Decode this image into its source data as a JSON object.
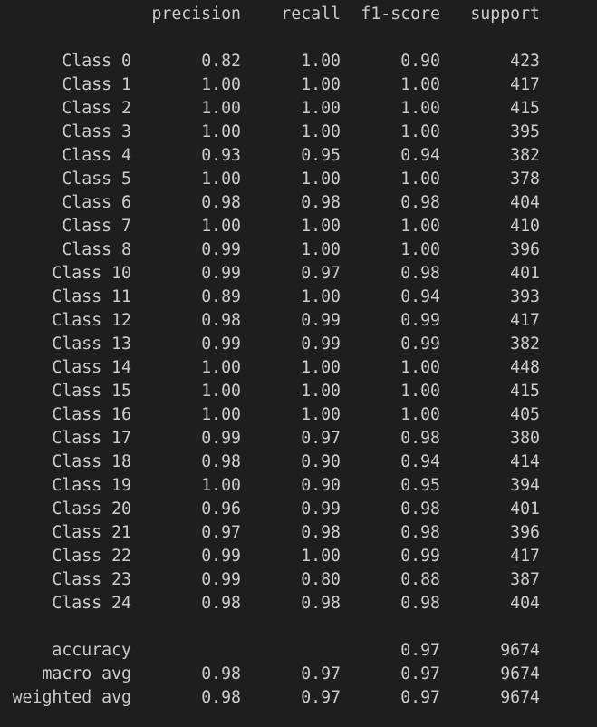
{
  "report": {
    "headers": [
      "precision",
      "recall",
      "f1-score",
      "support"
    ],
    "rows": [
      {
        "label": "Class 0",
        "precision": "0.82",
        "recall": "1.00",
        "f1": "0.90",
        "support": "423"
      },
      {
        "label": "Class 1",
        "precision": "1.00",
        "recall": "1.00",
        "f1": "1.00",
        "support": "417"
      },
      {
        "label": "Class 2",
        "precision": "1.00",
        "recall": "1.00",
        "f1": "1.00",
        "support": "415"
      },
      {
        "label": "Class 3",
        "precision": "1.00",
        "recall": "1.00",
        "f1": "1.00",
        "support": "395"
      },
      {
        "label": "Class 4",
        "precision": "0.93",
        "recall": "0.95",
        "f1": "0.94",
        "support": "382"
      },
      {
        "label": "Class 5",
        "precision": "1.00",
        "recall": "1.00",
        "f1": "1.00",
        "support": "378"
      },
      {
        "label": "Class 6",
        "precision": "0.98",
        "recall": "0.98",
        "f1": "0.98",
        "support": "404"
      },
      {
        "label": "Class 7",
        "precision": "1.00",
        "recall": "1.00",
        "f1": "1.00",
        "support": "410"
      },
      {
        "label": "Class 8",
        "precision": "0.99",
        "recall": "1.00",
        "f1": "1.00",
        "support": "396"
      },
      {
        "label": "Class 10",
        "precision": "0.99",
        "recall": "0.97",
        "f1": "0.98",
        "support": "401"
      },
      {
        "label": "Class 11",
        "precision": "0.89",
        "recall": "1.00",
        "f1": "0.94",
        "support": "393"
      },
      {
        "label": "Class 12",
        "precision": "0.98",
        "recall": "0.99",
        "f1": "0.99",
        "support": "417"
      },
      {
        "label": "Class 13",
        "precision": "0.99",
        "recall": "0.99",
        "f1": "0.99",
        "support": "382"
      },
      {
        "label": "Class 14",
        "precision": "1.00",
        "recall": "1.00",
        "f1": "1.00",
        "support": "448"
      },
      {
        "label": "Class 15",
        "precision": "1.00",
        "recall": "1.00",
        "f1": "1.00",
        "support": "415"
      },
      {
        "label": "Class 16",
        "precision": "1.00",
        "recall": "1.00",
        "f1": "1.00",
        "support": "405"
      },
      {
        "label": "Class 17",
        "precision": "0.99",
        "recall": "0.97",
        "f1": "0.98",
        "support": "380"
      },
      {
        "label": "Class 18",
        "precision": "0.98",
        "recall": "0.90",
        "f1": "0.94",
        "support": "414"
      },
      {
        "label": "Class 19",
        "precision": "1.00",
        "recall": "0.90",
        "f1": "0.95",
        "support": "394"
      },
      {
        "label": "Class 20",
        "precision": "0.96",
        "recall": "0.99",
        "f1": "0.98",
        "support": "401"
      },
      {
        "label": "Class 21",
        "precision": "0.97",
        "recall": "0.98",
        "f1": "0.98",
        "support": "396"
      },
      {
        "label": "Class 22",
        "precision": "0.99",
        "recall": "1.00",
        "f1": "0.99",
        "support": "417"
      },
      {
        "label": "Class 23",
        "precision": "0.99",
        "recall": "0.80",
        "f1": "0.88",
        "support": "387"
      },
      {
        "label": "Class 24",
        "precision": "0.98",
        "recall": "0.98",
        "f1": "0.98",
        "support": "404"
      }
    ],
    "summary": [
      {
        "label": "accuracy",
        "precision": "",
        "recall": "",
        "f1": "0.97",
        "support": "9674"
      },
      {
        "label": "macro avg",
        "precision": "0.98",
        "recall": "0.97",
        "f1": "0.97",
        "support": "9674"
      },
      {
        "label": "weighted avg",
        "precision": "0.98",
        "recall": "0.97",
        "f1": "0.97",
        "support": "9674"
      }
    ]
  },
  "colors": {
    "background": "#1e1e1e",
    "text": "#cccccc"
  }
}
